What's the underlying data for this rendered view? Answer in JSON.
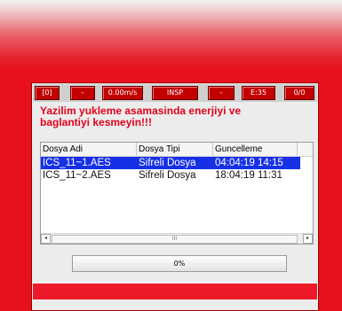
{
  "status_bar": [
    "[0]",
    "-",
    "0.00m/s",
    "INSP",
    "-",
    "E:35",
    "0/0"
  ],
  "warning": {
    "line1": "Yazilim yukleme asamasinda enerjiyi ve",
    "line2": "baglantiyi kesmeyin!!!"
  },
  "file_list": {
    "columns": [
      "Dosya Adi",
      "Dosya Tipi",
      "Guncelleme"
    ],
    "rows": [
      {
        "name": "ICS_11~1.AES",
        "type": "Sifreli Dosya",
        "updated": "04:04:19 14:15",
        "selected": true
      },
      {
        "name": "ICS_11~2.AES",
        "type": "Sifreli Dosya",
        "updated": "18:04:19 11:31",
        "selected": false
      }
    ],
    "scroll_left": "◂",
    "scroll_thumb": "III",
    "scroll_right": "▸"
  },
  "progress": {
    "label": "0%",
    "value": 0
  }
}
